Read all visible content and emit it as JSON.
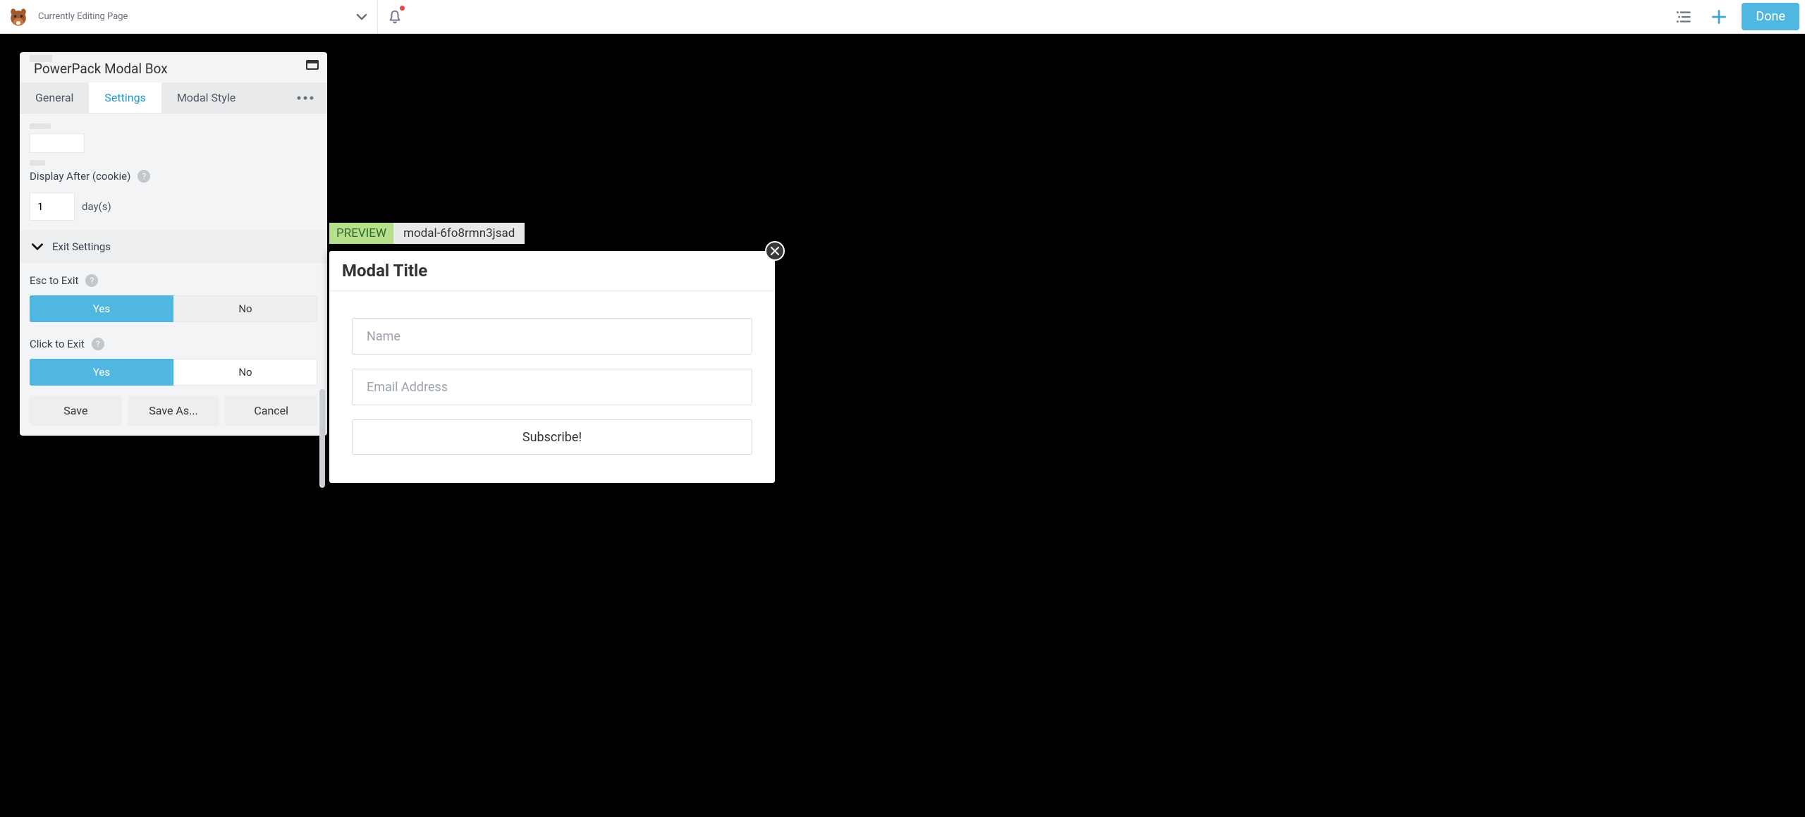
{
  "topbar": {
    "context": "Currently Editing Page",
    "done": "Done"
  },
  "panel": {
    "title": "PowerPack Modal Box",
    "tabs": {
      "general": "General",
      "settings": "Settings",
      "modal_style": "Modal Style"
    },
    "display_after_label": "Display After (cookie)",
    "display_after_value": "1",
    "display_after_unit": "day(s)",
    "section_exit": "Exit Settings",
    "esc_label": "Esc to Exit",
    "click_label": "Click to Exit",
    "yes": "Yes",
    "no": "No",
    "save": "Save",
    "save_as": "Save As...",
    "cancel": "Cancel"
  },
  "preview": {
    "badge": "PREVIEW",
    "id": "modal-6fo8rmn3jsad",
    "modal_title": "Modal Title",
    "name_placeholder": "Name",
    "email_placeholder": "Email Address",
    "subscribe": "Subscribe!"
  }
}
